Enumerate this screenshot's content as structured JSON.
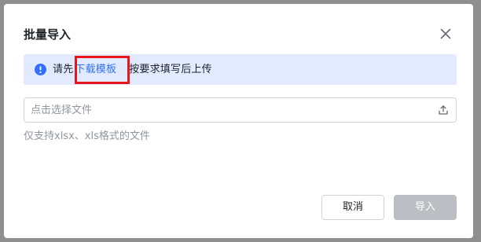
{
  "dialog": {
    "title": "批量导入",
    "close_icon": "close-icon"
  },
  "alert": {
    "icon": "info-icon",
    "prefix": "请先",
    "link_text": "下载模板",
    "suffix": "按要求填写后上传"
  },
  "file_input": {
    "placeholder": "点击选择文件",
    "icon": "upload-icon"
  },
  "hint": "仅支持xlsx、xls格式的文件",
  "buttons": {
    "cancel_label": "取消",
    "import_label": "导入"
  },
  "colors": {
    "accent": "#3370ff",
    "alert_bg": "#e1eaff",
    "highlight": "#e8151b",
    "disabled_btn": "#bbbfc4"
  }
}
